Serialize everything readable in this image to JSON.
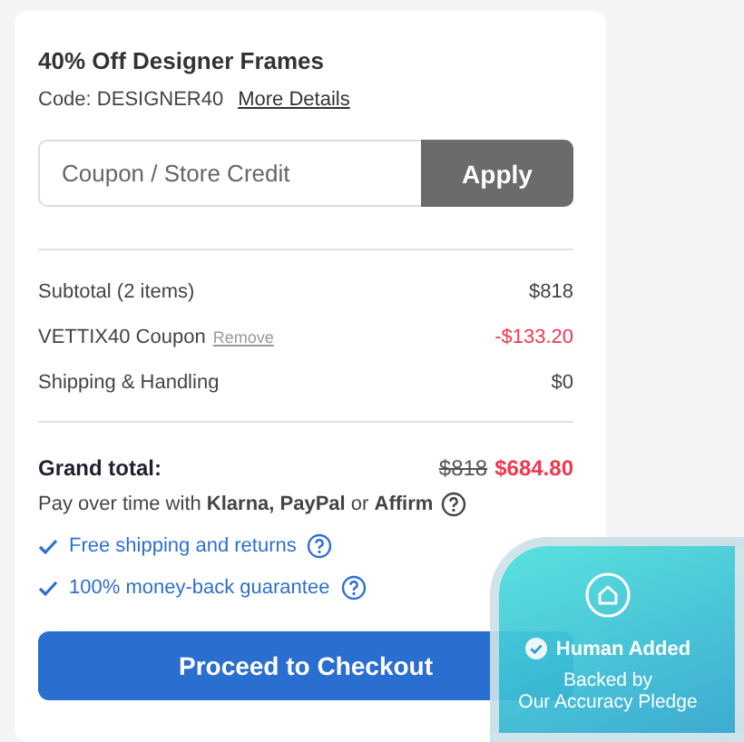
{
  "promo": {
    "title": "40% Off Designer Frames",
    "code": "Code: DESIGNER40",
    "details_link": "More Details"
  },
  "coupon_field": {
    "placeholder": "Coupon / Store Credit"
  },
  "apply_button": "Apply",
  "summary": [
    {
      "kind": "normal",
      "label": "Subtotal (2 items)",
      "value": "$818"
    },
    {
      "kind": "discount",
      "label": "VETTIX40 Coupon",
      "link": "Remove",
      "value": "-$133.20"
    },
    {
      "kind": "normal",
      "label": "Shipping & Handling",
      "value": "$0"
    }
  ],
  "grand_total": {
    "label": "Grand total:",
    "original": "$818",
    "price": "$684.80"
  },
  "financing": "Pay over time with **Klarna, PayPal** or **Affirm**",
  "benefits": [
    "Free shipping and returns",
    "100% money-back guarantee"
  ],
  "checkout_button": "Proceed to Checkout",
  "badge": {
    "title": "Human Added",
    "subtitle": [
      "Backed by",
      "Our Accuracy Pledge"
    ]
  }
}
